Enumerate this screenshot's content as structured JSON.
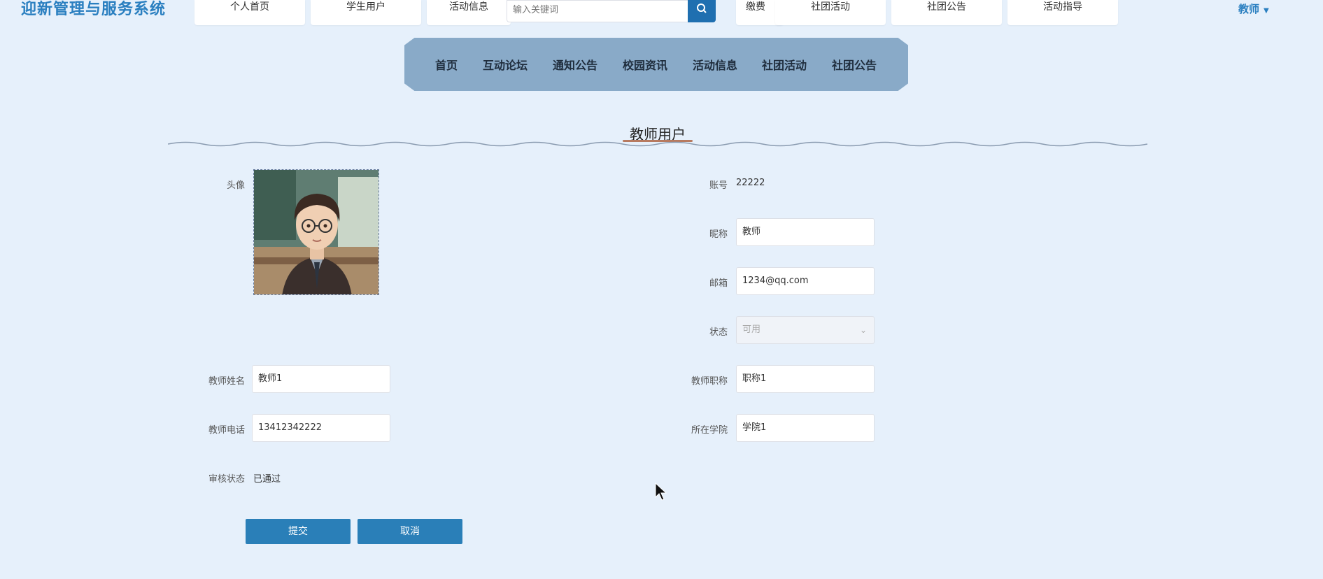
{
  "app": {
    "title": "迎新管理与服务系统"
  },
  "top_nav": [
    "个人首页",
    "学生用户",
    "活动信息",
    "缴费",
    "社团活动",
    "社团公告",
    "活动指导"
  ],
  "search": {
    "placeholder": "输入关键词"
  },
  "user_menu": {
    "label": "教师"
  },
  "main_nav": [
    "首页",
    "互动论坛",
    "通知公告",
    "校园资讯",
    "活动信息",
    "社团活动",
    "社团公告"
  ],
  "page": {
    "title": "教师用户"
  },
  "form": {
    "avatar_label": "头像",
    "account_label": "账号",
    "account_value": "22222",
    "nickname_label": "昵称",
    "nickname_value": "教师",
    "email_label": "邮箱",
    "email_value": "1234@qq.com",
    "status_label": "状态",
    "status_value": "可用",
    "teacher_name_label": "教师姓名",
    "teacher_name_value": "教师1",
    "teacher_title_label": "教师职称",
    "teacher_title_value": "职称1",
    "teacher_phone_label": "教师电话",
    "teacher_phone_value": "13412342222",
    "college_label": "所在学院",
    "college_value": "学院1",
    "review_label": "审核状态",
    "review_value": "已通过"
  },
  "buttons": {
    "submit": "提交",
    "cancel": "取消"
  },
  "colors": {
    "accent": "#2a7fb8",
    "nav_bg": "#89aac8",
    "page_bg": "#e6f0fb"
  }
}
